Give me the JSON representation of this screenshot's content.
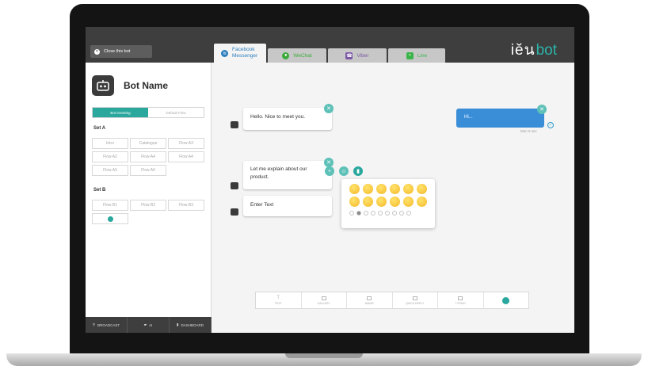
{
  "topbar": {
    "close_bot_label": "Close this bot",
    "logo_prefix": "iĕน",
    "logo_suffix": "bot"
  },
  "tabs": [
    {
      "label": "Facebook Messenger",
      "icon": "messenger-icon",
      "color": "#2b7dbd",
      "active": true
    },
    {
      "label": "WeChat",
      "icon": "wechat-icon",
      "color": "#3cab3a",
      "active": false
    },
    {
      "label": "Viber",
      "icon": "viber-icon",
      "color": "#7b57a6",
      "active": false
    },
    {
      "label": "Line",
      "icon": "line-icon",
      "color": "#3bb54a",
      "active": false
    }
  ],
  "sidebar": {
    "bot_name": "Bot Name",
    "segments": [
      "Bot Greeting",
      "Default Flow"
    ],
    "set_a_label": "Set A",
    "set_a_flows": [
      "Intro",
      "Catalogue",
      "Flow A3",
      "Flow A2",
      "Flow A4",
      "Flow A4",
      "Flow A5",
      "Flow A6"
    ],
    "set_b_label": "Set B",
    "set_b_flows": [
      "Flow B1",
      "Flow B2",
      "Flow B3"
    ],
    "bottom_nav": [
      "BROADCAST",
      "AI",
      "DASHBOARD"
    ]
  },
  "chat": {
    "msg1": "Hello. Nice to meet you.",
    "msg2": "Let me explain about our product.",
    "input_placeholder": "Enter Text",
    "user_msg": "Hi...",
    "user_time": "Mon 5 sec"
  },
  "bottom_tools": [
    "TEXT",
    "GALLERY",
    "IMAGE",
    "QUICK REPLY",
    "TYPING"
  ],
  "colors": {
    "accent": "#2aa89e",
    "user_bubble": "#3a8ed8",
    "dark_bar": "#3e3e3e"
  }
}
